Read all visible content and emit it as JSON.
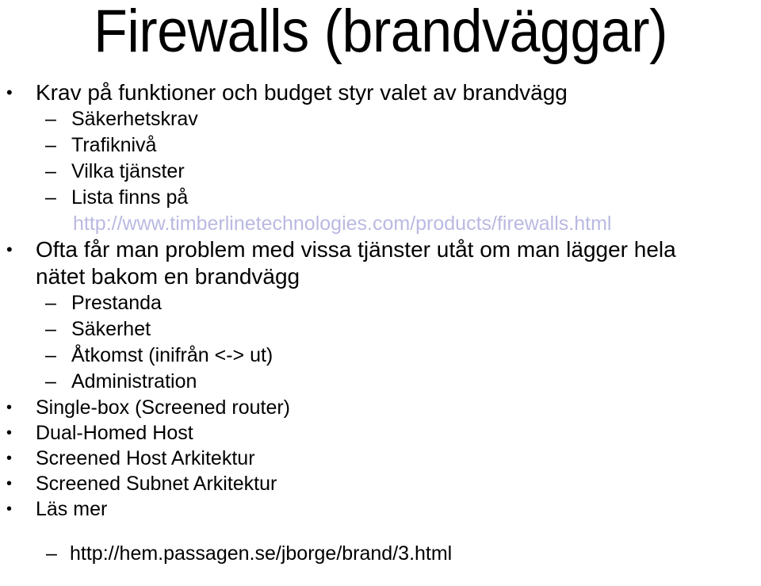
{
  "slide": {
    "title": "Firewalls (brandväggar)",
    "background_color": "#ffffff",
    "text_color": "#000000",
    "link_color": "#b9b9e2",
    "bullet_glyph_level1": "•",
    "bullet_glyph_level2": "–"
  },
  "content": {
    "b1": {
      "text": "Krav på funktioner och budget styr valet av brandvägg",
      "bullet": "•"
    },
    "b1s1": {
      "text": "Säkerhetskrav",
      "bullet": "–"
    },
    "b1s2": {
      "text": "Trafiknivå",
      "bullet": "–"
    },
    "b1s3": {
      "text": "Vilka tjänster",
      "bullet": "–"
    },
    "b1s4": {
      "text": "Lista finns på",
      "bullet": "–"
    },
    "b1s4_url": {
      "text": "http://www.timberlinetechnologies.com/products/firewalls.html"
    },
    "b2": {
      "line1": "Ofta får man problem med vissa tjänster utåt om man lägger hela",
      "line2": "nätet bakom en brandvägg",
      "bullet": "•"
    },
    "b2s1": {
      "text": "Prestanda",
      "bullet": "–"
    },
    "b2s2": {
      "text": "Säkerhet",
      "bullet": "–"
    },
    "b2s3": {
      "text": "Åtkomst (inifrån <-> ut)",
      "bullet": "–"
    },
    "b2s4": {
      "text": "Administration",
      "bullet": "–"
    },
    "b3": {
      "text": "Single-box (Screened router)",
      "bullet": "•"
    },
    "b4": {
      "text": "Dual-Homed Host",
      "bullet": "•"
    },
    "b5": {
      "text": "Screened Host Arkitektur",
      "bullet": "•"
    },
    "b6": {
      "text": "Screened Subnet Arkitektur",
      "bullet": "•"
    },
    "b7": {
      "text": "Läs mer",
      "bullet": "•"
    },
    "b7s1": {
      "text": "http://hem.passagen.se/jborge/brand/3.html",
      "bullet": "–"
    }
  }
}
